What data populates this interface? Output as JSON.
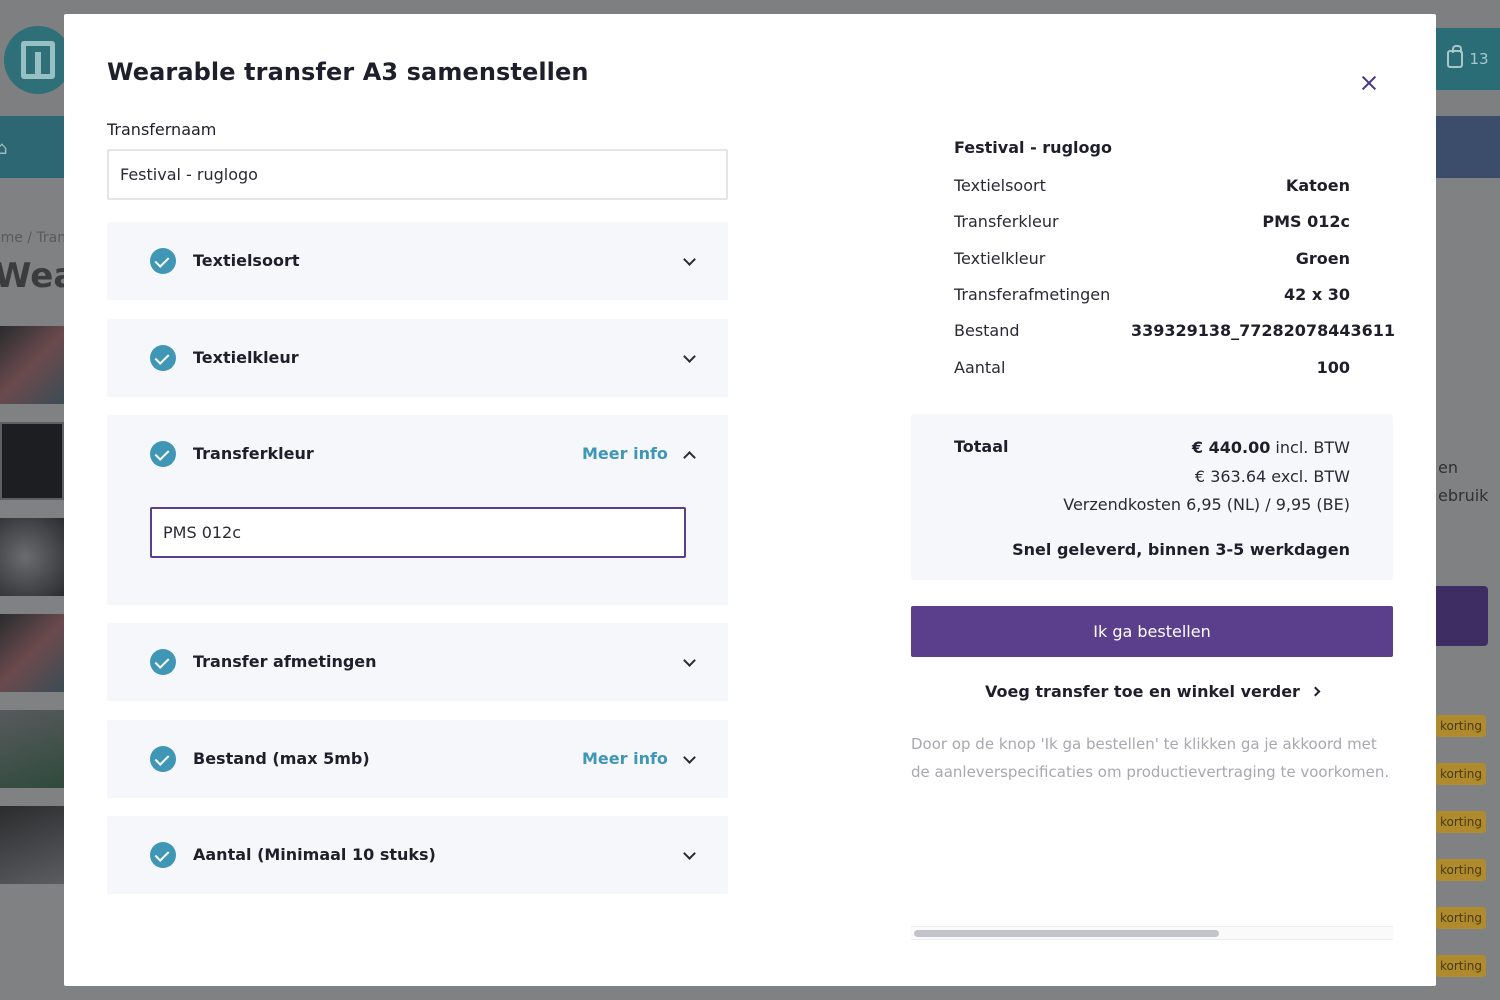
{
  "background": {
    "breadcrumb": "ome / Tran",
    "title_fragment": "Wea",
    "cart_count": "13",
    "side_text": [
      "en",
      "ebruik"
    ],
    "badge_label": "korting",
    "badge_count": 6
  },
  "modal": {
    "title": "Wearable transfer A3 samenstellen",
    "close_icon": "close-icon"
  },
  "form": {
    "name_label": "Transfernaam",
    "name_value": "Festival - ruglogo",
    "sections": [
      {
        "label": "Textielsoort",
        "meer_info": "",
        "expanded": false
      },
      {
        "label": "Textielkleur",
        "meer_info": "",
        "expanded": false
      },
      {
        "label": "Transferkleur",
        "meer_info": "Meer info",
        "expanded": true,
        "input_value": "PMS 012c"
      },
      {
        "label": "Transfer afmetingen",
        "meer_info": "",
        "expanded": false
      },
      {
        "label": "Bestand (max 5mb)",
        "meer_info": "Meer info",
        "expanded": false
      },
      {
        "label": "Aantal (Minimaal 10 stuks)",
        "meer_info": "",
        "expanded": false
      }
    ]
  },
  "summary": {
    "title": "Festival - ruglogo",
    "rows": [
      {
        "key": "Textielsoort",
        "value": "Katoen"
      },
      {
        "key": "Transferkleur",
        "value": "PMS 012c"
      },
      {
        "key": "Textielkleur",
        "value": "Groen"
      },
      {
        "key": "Transferafmetingen",
        "value": "42 x 30"
      },
      {
        "key": "Bestand",
        "value": "339329138_77282078443611"
      },
      {
        "key": "Aantal",
        "value": "100"
      }
    ]
  },
  "total": {
    "label": "Totaal",
    "incl_amount": "€ 440.00",
    "incl_suffix": " incl. BTW",
    "excl": "€ 363.64 excl. BTW",
    "shipping": "Verzendkosten 6,95 (NL) / 9,95 (BE)",
    "delivery": "Snel geleverd, binnen 3-5 werkdagen"
  },
  "actions": {
    "order_label": "Ik ga bestellen",
    "continue_label": "Voeg transfer toe en winkel verder",
    "disclaimer": "Door op de knop 'Ik ga bestellen' te klikken ga je akkoord met de aanleverspecificaties om productievertraging te voorkomen."
  },
  "colors": {
    "accent_purple": "#5b3f8c",
    "check_blue": "#3f97b5",
    "panel_bg": "#f6f7fb",
    "overlay": "#7f8182"
  }
}
